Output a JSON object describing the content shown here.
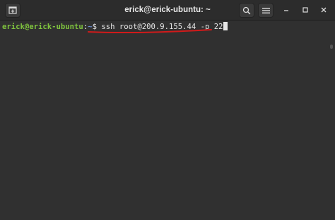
{
  "window": {
    "title": "erick@erick-ubuntu: ~"
  },
  "terminal": {
    "prompt_user_host": "erick@erick-ubuntu",
    "prompt_colon": ":",
    "prompt_path": "~",
    "prompt_symbol": "$ ",
    "command": "ssh root@200.9.155.44 -p 22"
  },
  "colors": {
    "annotation_underline": "#d11a1a",
    "prompt_user": "#7fc33e",
    "prompt_path": "#6e8fd6"
  },
  "icons": {
    "new_tab": "new-tab-icon",
    "search": "search-icon",
    "menu": "hamburger-menu-icon",
    "minimize": "minimize-icon",
    "maximize": "maximize-icon",
    "close": "close-icon"
  }
}
